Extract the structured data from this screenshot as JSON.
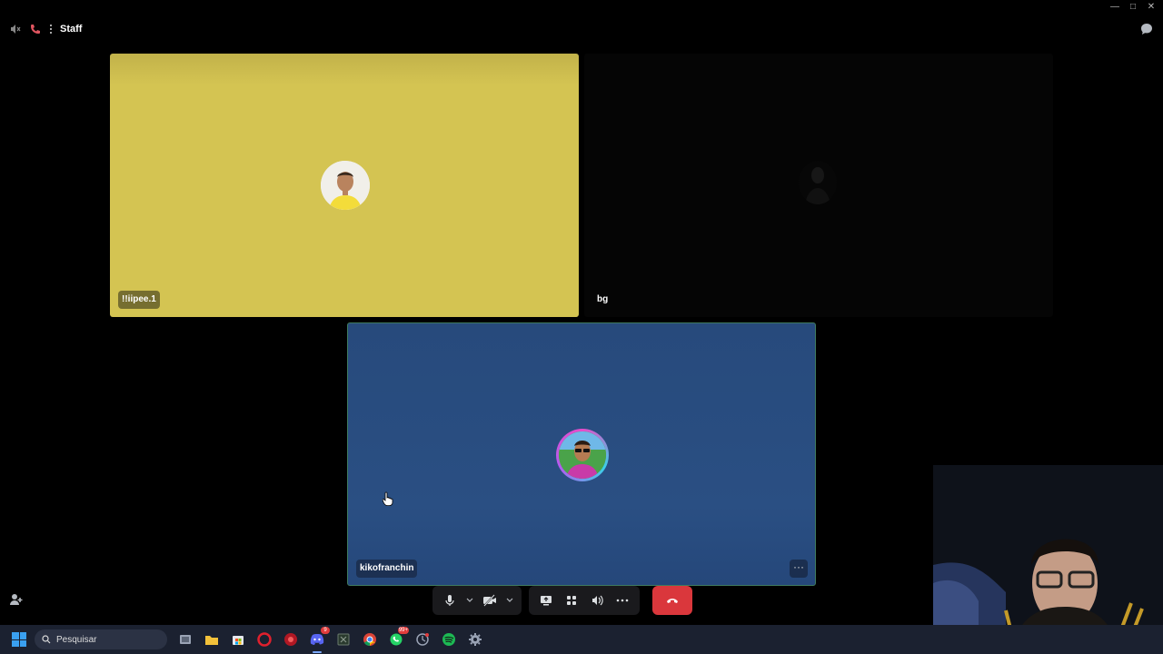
{
  "titlebar": {
    "channel_name": "Staff",
    "icons": [
      "speaker-icon",
      "phone-icon",
      "voice-channel-icon",
      "chat-icon"
    ],
    "window_controls": [
      "minimize",
      "maximize",
      "close"
    ]
  },
  "participants": [
    {
      "name": "!!iipee.1",
      "tile_color": "#d4c452",
      "avatar": "avatar-yellow-shirt"
    },
    {
      "name": "bg",
      "tile_color": "#050505",
      "avatar": "avatar-dark"
    },
    {
      "name": "kikofranchin",
      "tile_color": "#2a4f83",
      "avatar": "avatar-sunglasses",
      "speaking": true
    }
  ],
  "controls": {
    "buttons": [
      "microphone-icon",
      "camera-off-icon",
      "screen-share-icon",
      "activities-icon",
      "soundboard-icon",
      "more-icon",
      "end-call-icon"
    ],
    "end_color": "#da373c"
  },
  "taskbar": {
    "search_placeholder": "Pesquisar",
    "apps": [
      "task-view",
      "file-explorer",
      "microsoft-store",
      "opera",
      "record",
      "discord",
      "excel",
      "chrome",
      "whatsapp",
      "app",
      "spotify",
      "settings"
    ],
    "badges": {
      "discord": "9",
      "whatsapp": "99+"
    }
  }
}
